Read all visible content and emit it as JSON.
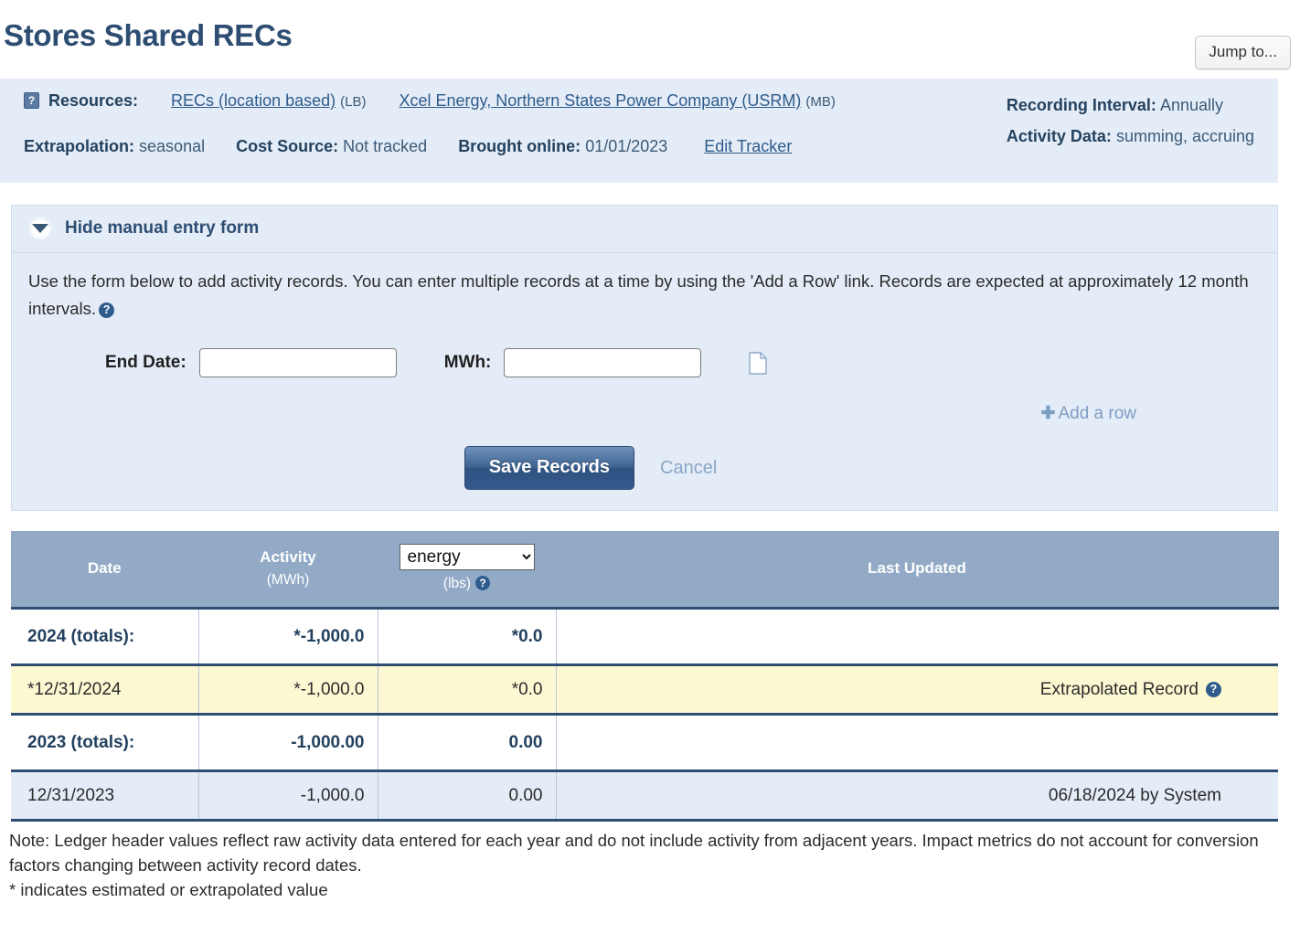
{
  "page": {
    "title": "Stores Shared RECs",
    "jump_to_label": "Jump to..."
  },
  "info": {
    "resources_label": "Resources:",
    "resources_help_icon": "question-mark-icon",
    "resource_items": [
      {
        "link": "RECs (location based)",
        "suffix": "(LB)"
      },
      {
        "link": "Xcel Energy, Northern States Power Company (USRM)",
        "suffix": "(MB)"
      }
    ],
    "recording_interval_label": "Recording Interval:",
    "recording_interval_value": "Annually",
    "activity_data_label": "Activity Data:",
    "activity_data_value": "summing, accruing",
    "extrapolation_label": "Extrapolation:",
    "extrapolation_value": "seasonal",
    "cost_source_label": "Cost Source:",
    "cost_source_value": "Not tracked",
    "brought_online_label": "Brought online:",
    "brought_online_value": "01/01/2023",
    "edit_tracker_label": "Edit Tracker"
  },
  "form": {
    "toggle_label": "Hide manual entry form",
    "toggle_icon": "triangle-down-icon",
    "description": "Use the form below to add activity records. You can enter multiple records at a time by using the 'Add a Row' link. Records are expected at approximately 12 month intervals.",
    "description_help_icon": "question-circle-icon",
    "end_date_label": "End Date:",
    "end_date_value": "",
    "mwh_label": "MWh:",
    "mwh_value": "",
    "document_icon": "document-page-icon",
    "add_row_label": "Add a row",
    "add_row_icon": "plus-icon",
    "save_label": "Save Records",
    "cancel_label": "Cancel"
  },
  "table": {
    "columns": {
      "date": "Date",
      "activity": "Activity",
      "activity_unit": "(MWh)",
      "impact_selected": "energy",
      "impact_options": [
        "energy"
      ],
      "impact_unit": "(lbs)",
      "impact_help_icon": "question-circle-icon",
      "last_updated": "Last Updated"
    },
    "rows": [
      {
        "kind": "totals",
        "date": "2024 (totals):",
        "activity": "*-1,000.0",
        "impact": "*0.0",
        "updated": ""
      },
      {
        "kind": "record",
        "highlight": "yellow",
        "date": "*12/31/2024",
        "activity": "*-1,000.0",
        "impact": "*0.0",
        "updated": "Extrapolated Record",
        "updated_help_icon": "question-circle-icon"
      },
      {
        "kind": "totals",
        "date": "2023 (totals):",
        "activity": "-1,000.00",
        "impact": "0.00",
        "updated": ""
      },
      {
        "kind": "record",
        "highlight": "blue",
        "date": "12/31/2023",
        "activity": "-1,000.0",
        "impact": "0.00",
        "updated": "06/18/2024 by System"
      }
    ]
  },
  "notes": {
    "line1": "Note: Ledger header values reflect raw activity data entered for each year and do not include activity from adjacent years. Impact metrics do not account for conversion factors changing between activity record dates.",
    "line2": "* indicates estimated or extrapolated value"
  },
  "colors": {
    "title": "#2e4d72",
    "panel_bg": "#e4ecf7",
    "table_header_bg": "#92aac6",
    "row_highlight": "#fcf8d2",
    "row_alt": "#e4ecf7",
    "link": "#2e5b8c",
    "save_button": "#3f6391"
  }
}
